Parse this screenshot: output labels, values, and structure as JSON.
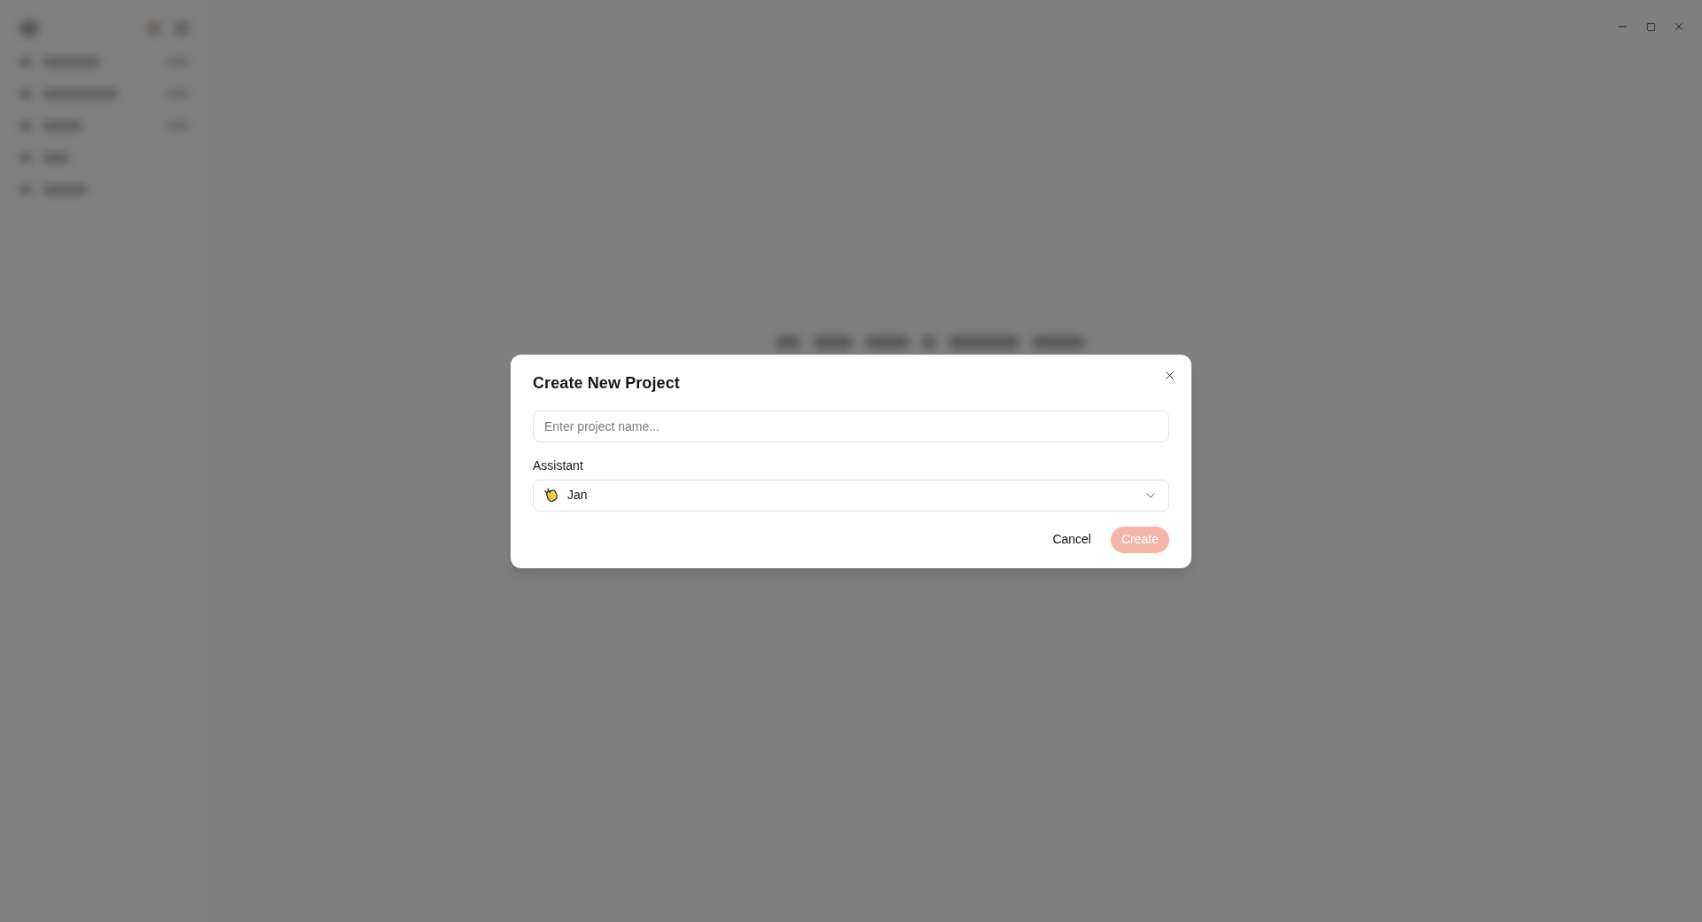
{
  "window_controls": [
    {
      "kind": "minimize"
    },
    {
      "kind": "maximize"
    },
    {
      "kind": "close"
    }
  ],
  "dialog": {
    "title": "Create New Project",
    "name_field": {
      "placeholder": "Enter project name..."
    },
    "assistant_label": "Assistant",
    "assistant_select": {
      "value": "Jan"
    },
    "buttons": [
      {
        "label": "Cancel",
        "kind": "secondary",
        "disabled": false
      },
      {
        "label": "Create",
        "kind": "primary",
        "disabled": true
      }
    ]
  }
}
